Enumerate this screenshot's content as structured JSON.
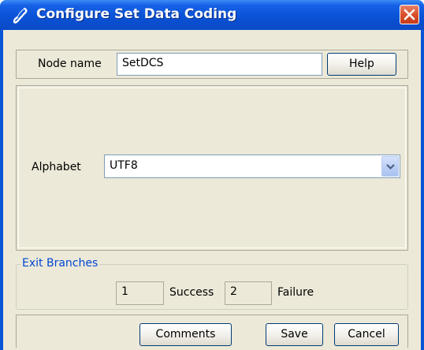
{
  "window": {
    "title": "Configure Set Data Coding",
    "title_icon": "pen-icon",
    "close_icon": "close-icon"
  },
  "node": {
    "label": "Node name",
    "value": "SetDCS",
    "help_label": "Help"
  },
  "alphabet": {
    "label": "Alphabet",
    "selected": "UTF8"
  },
  "exit_branches": {
    "title": "Exit Branches",
    "branches": [
      {
        "number": "1",
        "label": "Success"
      },
      {
        "number": "2",
        "label": "Failure"
      }
    ]
  },
  "buttons": {
    "comments": "Comments",
    "save": "Save",
    "cancel": "Cancel"
  },
  "colors": {
    "titlebar": "#0a52d6",
    "dialog_bg": "#ece9d8",
    "group_title": "#0046d5",
    "close_button": "#d9502c"
  }
}
